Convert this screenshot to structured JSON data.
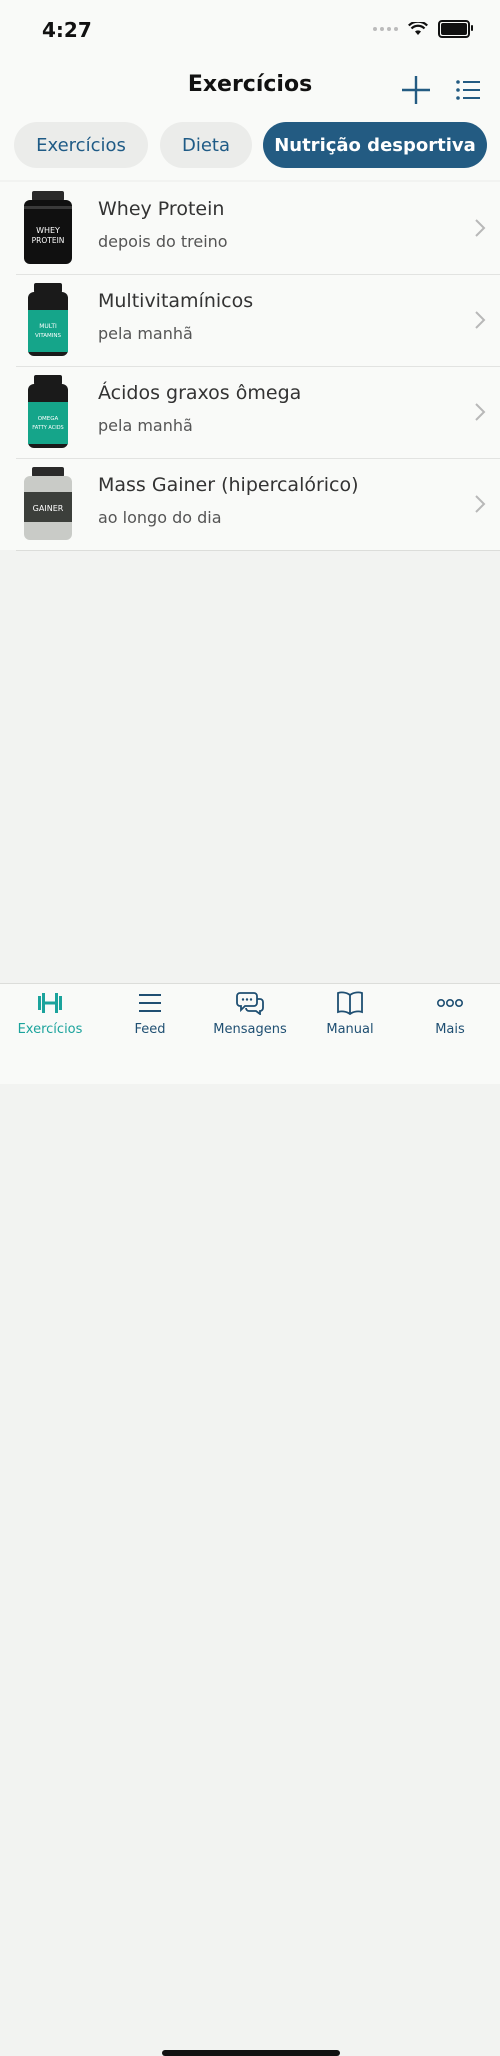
{
  "status_bar": {
    "time": "4:27"
  },
  "header": {
    "title": "Exercícios",
    "add_icon": "plus-icon",
    "list_icon": "list-icon"
  },
  "tabs": [
    {
      "label": "Exercícios",
      "active": false
    },
    {
      "label": "Dieta",
      "active": false
    },
    {
      "label": "Nutrição desportiva",
      "active": true
    }
  ],
  "supplements": [
    {
      "name": "Whey Protein",
      "timing": "depois do treino",
      "jar_label": [
        "WHEY",
        "PROTEIN"
      ],
      "jar_color": "#111111"
    },
    {
      "name": "Multivitamínicos",
      "timing": "pela manhã",
      "jar_label": [
        "MULTI",
        "VITAMINS"
      ],
      "jar_color": "#15a58a"
    },
    {
      "name": "Ácidos graxos ômega",
      "timing": "pela manhã",
      "jar_label": [
        "OMEGA",
        "FATTY ACIDS"
      ],
      "jar_color": "#15a58a"
    },
    {
      "name": "Mass Gainer (hipercalórico)",
      "timing": "ao longo do dia",
      "jar_label": [
        "GAINER"
      ],
      "jar_color": "#c9cbc7"
    }
  ],
  "tab_bar": [
    {
      "label": "Exercícios",
      "icon": "dumbbell-icon",
      "active": true
    },
    {
      "label": "Feed",
      "icon": "feed-icon",
      "active": false
    },
    {
      "label": "Mensagens",
      "icon": "chat-icon",
      "active": false
    },
    {
      "label": "Manual",
      "icon": "book-icon",
      "active": false
    },
    {
      "label": "Mais",
      "icon": "more-icon",
      "active": false
    }
  ],
  "colors": {
    "accent": "#235b82",
    "active_tab": "#1ba39c",
    "background": "#f2f3f1"
  }
}
